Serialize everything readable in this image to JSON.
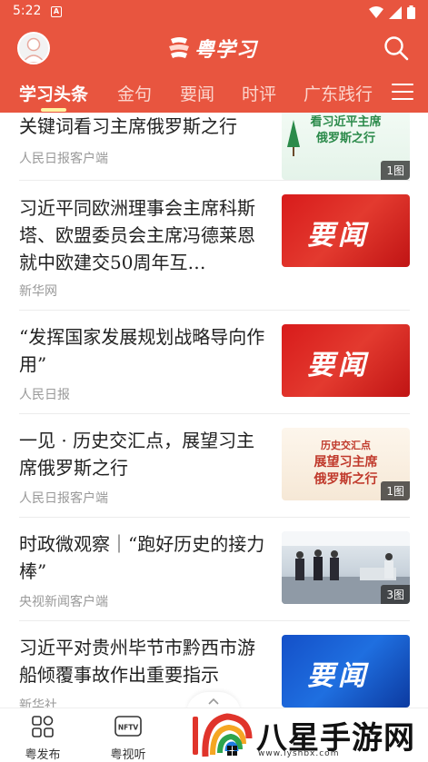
{
  "status_bar": {
    "time": "5:22",
    "app_icon_letter": "A"
  },
  "header": {
    "logo_text": "粤学习"
  },
  "tabs": [
    "学习头条",
    "金句",
    "要闻",
    "时评",
    "广东践行"
  ],
  "active_tab": "学习头条",
  "feed": [
    {
      "title": "关键词看习主席俄罗斯之行",
      "source": "人民日报客户端",
      "thumb": "poster",
      "thumb_text": [
        "看习近平主席",
        "俄罗斯之行"
      ],
      "badge": "1图"
    },
    {
      "title": "习近平同欧洲理事会主席科斯塔、欧盟委员会主席冯德莱恩就中欧建交50周年互…",
      "source": "新华网",
      "thumb": "yaowen",
      "thumb_text": [
        "要闻"
      ],
      "badge": ""
    },
    {
      "title": "“发挥国家发展规划战略导向作用”",
      "source": "人民日报",
      "thumb": "yaowen",
      "thumb_text": [
        "要闻"
      ],
      "badge": ""
    },
    {
      "title": "一见 · 历史交汇点，展望习主席俄罗斯之行",
      "source": "人民日报客户端",
      "thumb": "poster2",
      "thumb_text": [
        "历史交汇点",
        "展望习主席",
        "俄罗斯之行"
      ],
      "badge": "1图"
    },
    {
      "title": "时政微观察｜“跑好历史的接力棒”",
      "source": "央视新闻客户端",
      "thumb": "photo",
      "thumb_text": [],
      "badge": "3图"
    },
    {
      "title": "习近平对贵州毕节市黔西市游船倾覆事故作出重要指示",
      "source": "新华社",
      "thumb": "yaowen-blue",
      "thumb_text": [
        "要闻"
      ],
      "badge": ""
    }
  ],
  "bottom_nav": [
    {
      "label": "粤发布",
      "icon": "grid-icon"
    },
    {
      "label": "粤视听",
      "icon": "tv-icon",
      "icon_text": "NFTV"
    }
  ],
  "watermark": {
    "text": "八星手游网",
    "url": "www.lyshbx.com"
  },
  "colors": {
    "brand": "#e8553f",
    "text": "#222222",
    "source": "#999999"
  }
}
